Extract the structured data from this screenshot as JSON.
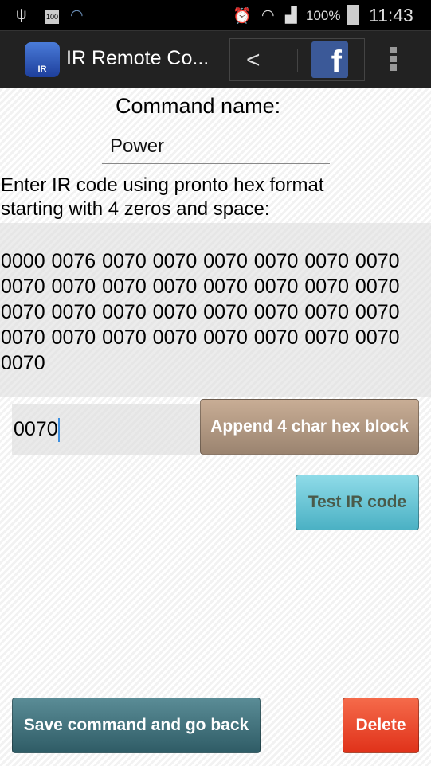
{
  "status_bar": {
    "battery_small": "100",
    "battery": "100%",
    "time": "11:43"
  },
  "action_bar": {
    "title": "IR Remote Co...",
    "icon_label": "IR",
    "fb_label": "f"
  },
  "form": {
    "command_name_label": "Command name:",
    "command_name_value": "Power",
    "instructions": "Enter IR code using pronto hex format starting with 4 zeros and space:",
    "ir_code": "0000 0076 0070 0070 0070 0070 0070 0070 0070 0070 0070 0070 0070 0070 0070 0070 0070 0070 0070 0070 0070 0070 0070 0070 0070 0070 0070 0070 0070 0070 0070 0070 0070",
    "hex_block_value": "0070",
    "append_label": "Append 4 char hex block",
    "test_label": "Test IR code",
    "save_label": "Save command and go back",
    "delete_label": "Delete"
  },
  "colors": {
    "append": "#b09a84",
    "test": "#6cc8d8",
    "save": "#437680",
    "delete": "#ea4a2e"
  }
}
